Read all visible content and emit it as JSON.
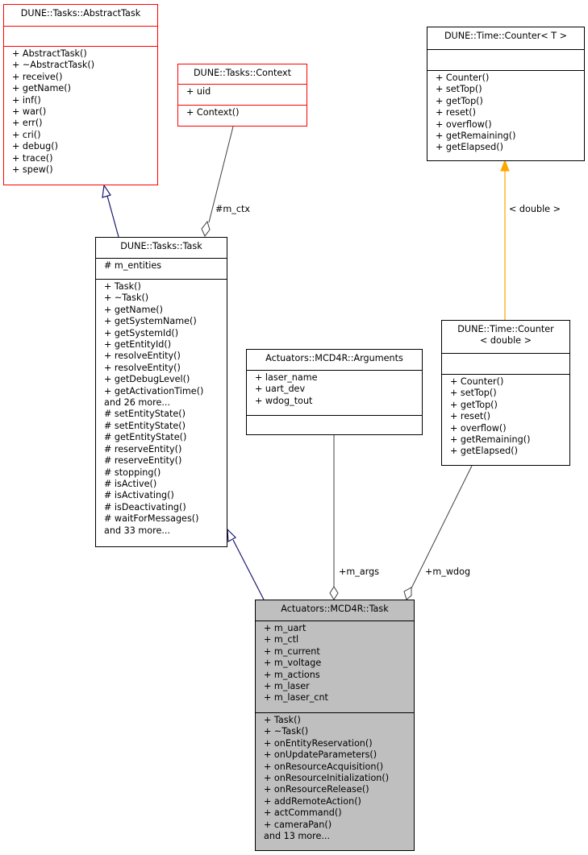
{
  "classes": {
    "abstract_task": {
      "name": "DUNE::Tasks::AbstractTask",
      "attributes": [],
      "methods": [
        "+ AbstractTask()",
        "+ ~AbstractTask()",
        "+ receive()",
        "+ getName()",
        "+ inf()",
        "+ war()",
        "+ err()",
        "+ cri()",
        "+ debug()",
        "+ trace()",
        "+ spew()"
      ]
    },
    "context": {
      "name": "DUNE::Tasks::Context",
      "attributes": [
        "+ uid"
      ],
      "methods": [
        "+ Context()"
      ]
    },
    "counter_t": {
      "name": "DUNE::Time::Counter< T >",
      "attributes": [],
      "methods": [
        "+ Counter()",
        "+ setTop()",
        "+ getTop()",
        "+ reset()",
        "+ overflow()",
        "+ getRemaining()",
        "+ getElapsed()"
      ]
    },
    "tasks_task": {
      "name": "DUNE::Tasks::Task",
      "attributes": [
        "# m_entities"
      ],
      "methods": [
        "+ Task()",
        "+ ~Task()",
        "+ getName()",
        "+ getSystemName()",
        "+ getSystemId()",
        "+ getEntityId()",
        "+ resolveEntity()",
        "+ resolveEntity()",
        "+ getDebugLevel()",
        "+ getActivationTime()",
        "and 26 more...",
        "# setEntityState()",
        "# setEntityState()",
        "# getEntityState()",
        "# reserveEntity()",
        "# reserveEntity()",
        "# stopping()",
        "# isActive()",
        "# isActivating()",
        "# isDeactivating()",
        "# waitForMessages()",
        "and 33 more..."
      ]
    },
    "arguments": {
      "name": "Actuators::MCD4R::Arguments",
      "attributes": [
        "+ laser_name",
        "+ uart_dev",
        "+ wdog_tout"
      ],
      "methods": []
    },
    "counter_double": {
      "name_line1": "DUNE::Time::Counter",
      "name_line2": "< double >",
      "attributes": [],
      "methods": [
        "+ Counter()",
        "+ setTop()",
        "+ getTop()",
        "+ reset()",
        "+ overflow()",
        "+ getRemaining()",
        "+ getElapsed()"
      ]
    },
    "mcd4r_task": {
      "name": "Actuators::MCD4R::Task",
      "attributes": [
        "+ m_uart",
        "+ m_ctl",
        "+ m_current",
        "+ m_voltage",
        "+ m_actions",
        "+ m_laser",
        "+ m_laser_cnt"
      ],
      "methods": [
        "+ Task()",
        "+ ~Task()",
        "+ onEntityReservation()",
        "+ onUpdateParameters()",
        "+ onResourceAcquisition()",
        "+ onResourceInitialization()",
        "+ onResourceRelease()",
        "+ addRemoteAction()",
        "+ actCommand()",
        "+ cameraPan()",
        "and 13 more..."
      ]
    }
  },
  "edges": {
    "m_ctx": "#m_ctx",
    "template_arg": "< double >",
    "m_args": "+m_args",
    "m_wdog": "+m_wdog"
  },
  "colors": {
    "inheritance": "#191970",
    "template": "#ffa500",
    "aggregation": "#404040",
    "undocumented_border": "#ff0000",
    "focus_fill": "#bfbfbf"
  }
}
